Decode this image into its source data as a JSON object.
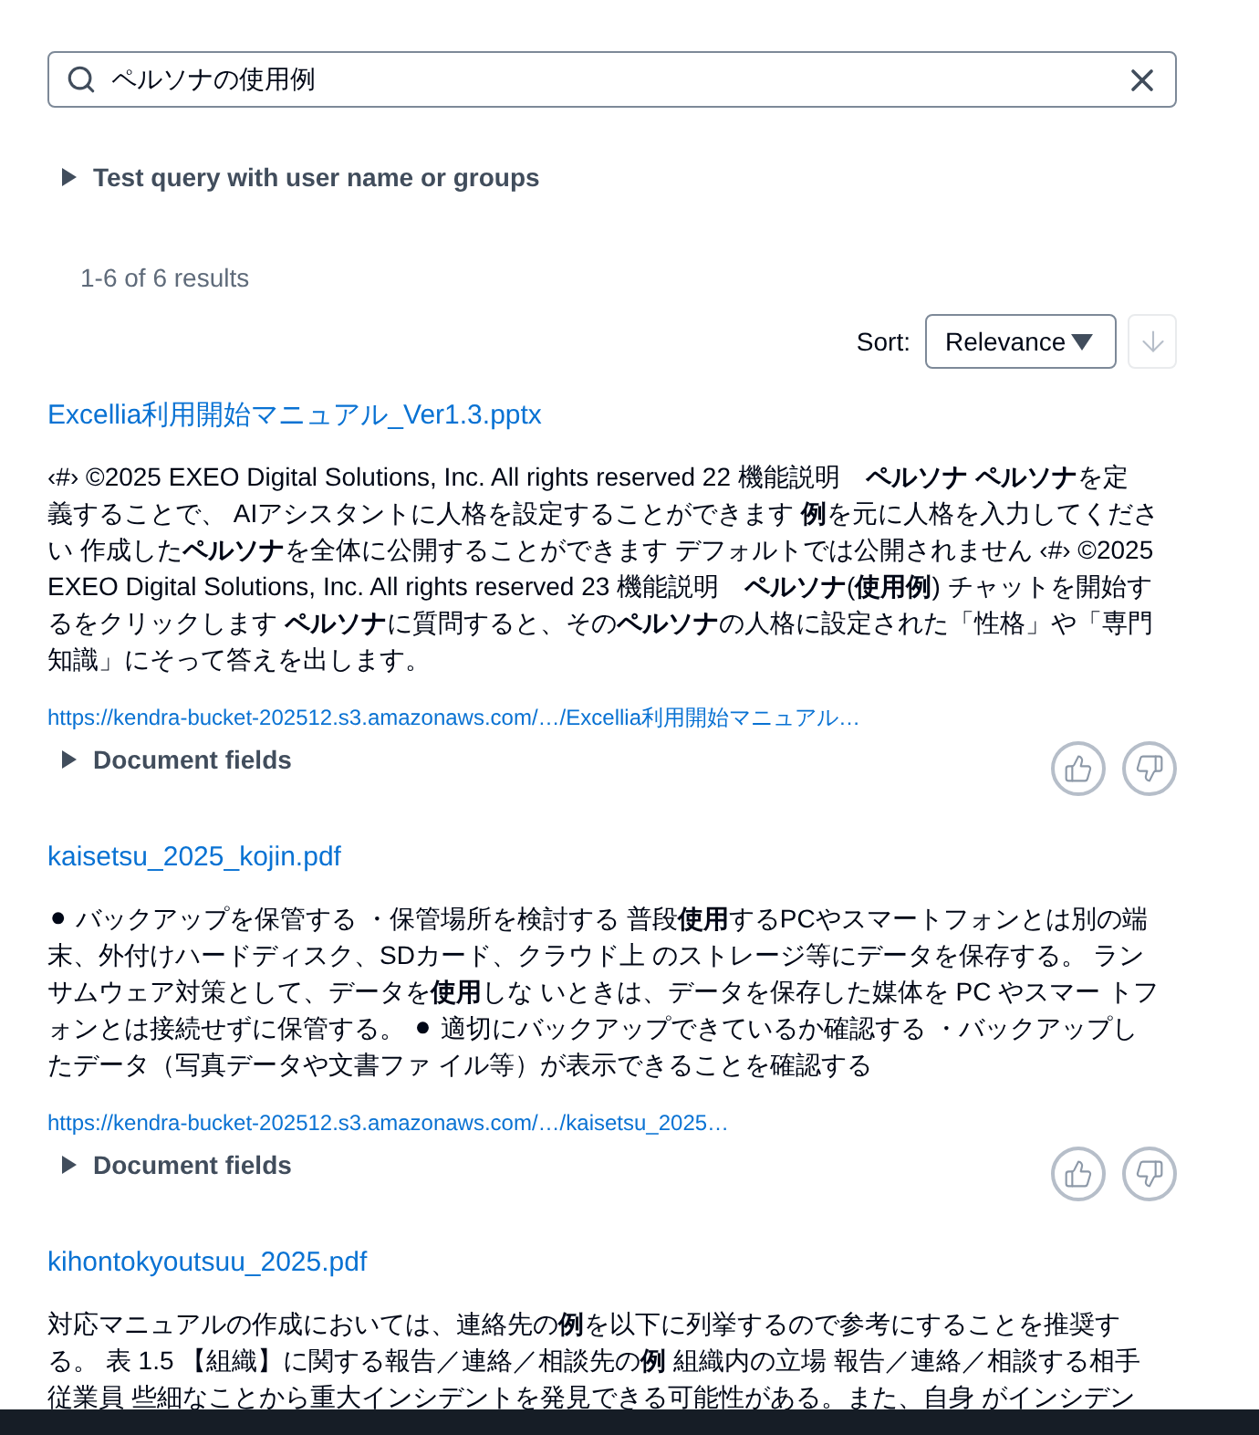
{
  "search": {
    "value": "ペルソナの使用例"
  },
  "test_query": {
    "label": "Test query with user name or groups",
    "expanded": false
  },
  "results_count": "1-6 of 6 results",
  "sort": {
    "label": "Sort:",
    "value": "Relevance",
    "direction_disabled": true
  },
  "results": [
    {
      "title": "Excellia利用開始マニュアル_Ver1.3.pptx",
      "snippet_lines": [
        "‹#› ©2025 EXEO Digital Solutions, Inc. All rights reserved 22 機能説明　**ペルソナ ペルソナ**を定",
        "義することで、 AIアシスタントに人格を設定することができます **例**を元に人格を入力してくださ",
        "い 作成した**ペルソナ**を全体に公開することができます デフォルトでは公開されません ‹#› ©2025",
        "EXEO Digital Solutions, Inc. All rights reserved 23 機能説明　**ペルソナ**(**使用例**) チャットを開始す",
        "るをクリックします **ペルソナ**に質問すると、その**ペルソナ**の人格に設定された「性格」や「専門",
        "知識」にそって答えを出します。"
      ],
      "url": "https://kendra-bucket-202512.s3.amazonaws.com/…/Excellia利用開始マニュアル…",
      "fields": {
        "label": "Document fields",
        "expanded": false
      }
    },
    {
      "title": "kaisetsu_2025_kojin.pdf",
      "snippet_lines": [
        "⚫ バックアップを保管する ・保管場所を検討する 普段**使用**するPCやスマートフォンとは別の端",
        "末、外付けハードディスク、SDカード、クラウド上 のストレージ等にデータを保存する。 ラン",
        "サムウェア対策として、データを**使用**しな いときは、データを保存した媒体を PC やスマー トフ",
        "ォンとは接続せずに保管する。 ⚫ 適切にバックアップできているか確認する ・バックアップし",
        "たデータ（写真データや文書ファ イル等）が表示できることを確認する"
      ],
      "url": "https://kendra-bucket-202512.s3.amazonaws.com/…/kaisetsu_2025…",
      "fields": {
        "label": "Document fields",
        "expanded": false
      }
    },
    {
      "title": "kihontokyoutsuu_2025.pdf",
      "snippet_lines": [
        "対応マニュアルの作成においては、連絡先の**例**を以下に列挙するので参考にすることを推奨す",
        "る。 表 1.5 【組織】に関する報告／連絡／相談先の**例** 組織内の立場 報告／連絡／相談する相手",
        "従業員 些細なことから重大インシデントを発見できる可能性がある。また、自身 がインシデン"
      ]
    }
  ]
}
